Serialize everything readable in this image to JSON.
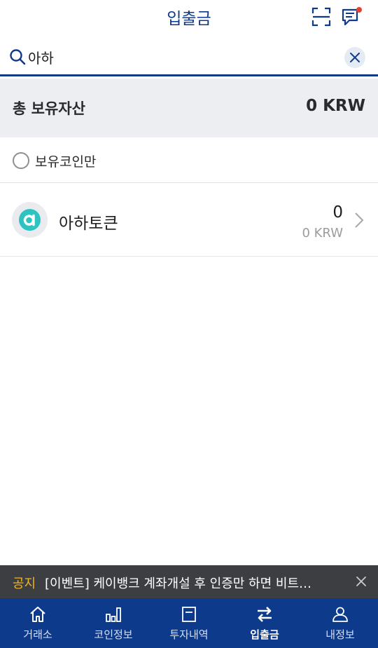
{
  "header": {
    "title": "입출금"
  },
  "search": {
    "value": "아하"
  },
  "total": {
    "label": "총 보유자산",
    "value": "0 KRW"
  },
  "filter": {
    "label": "보유코인만",
    "checked": false
  },
  "coins": [
    {
      "name": "아하토큰",
      "amount": "0",
      "krw_value": "0 KRW",
      "icon": "aha-token-logo",
      "color": "#2cc3c0"
    }
  ],
  "notice": {
    "tag": "공지",
    "text": "[이벤트] 케이뱅크 계좌개설 후 인증만 하면 비트…"
  },
  "nav": {
    "items": [
      {
        "label": "거래소",
        "icon": "home-icon",
        "active": false
      },
      {
        "label": "코인정보",
        "icon": "bar-chart-icon",
        "active": false
      },
      {
        "label": "투자내역",
        "icon": "document-icon",
        "active": false
      },
      {
        "label": "입출금",
        "icon": "transfer-icon",
        "active": true
      },
      {
        "label": "내정보",
        "icon": "user-icon",
        "active": false
      }
    ]
  },
  "colors": {
    "brand": "#0e3a8c",
    "notice_tag": "#f2b51a",
    "alert_dot": "#e8402f"
  }
}
